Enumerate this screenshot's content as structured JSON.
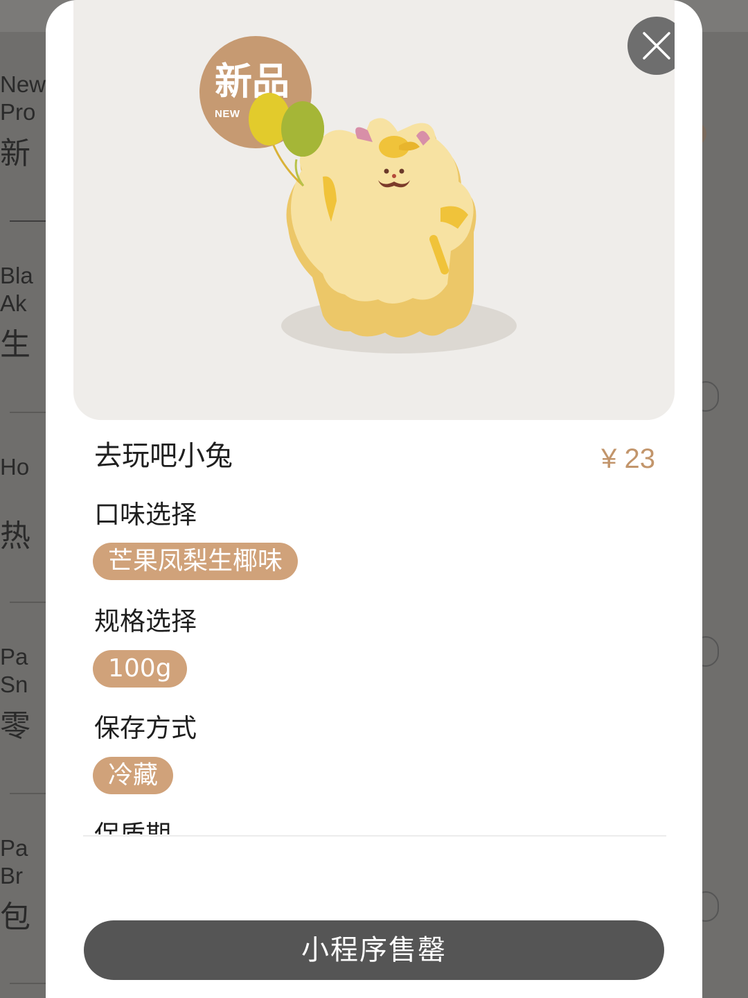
{
  "background_menu": {
    "categories": [
      {
        "en_line1": "New",
        "en_line2": "Pro",
        "zh": "新"
      },
      {
        "en_line1": "Bla",
        "en_line2": "Ak",
        "zh": "生"
      },
      {
        "en_line1": "Ho",
        "en_line2": "",
        "zh": "热"
      },
      {
        "en_line1": "Pa",
        "en_line2": "Sn",
        "zh": "零"
      },
      {
        "en_line1": "Pa",
        "en_line2": "Br",
        "zh": "包"
      }
    ]
  },
  "product": {
    "badge_zh": "新品",
    "badge_en": "NEW",
    "image_icon": "bunny-cake-with-balloons",
    "name": "去玩吧小兔",
    "price": "¥ 23"
  },
  "options": {
    "flavor": {
      "label": "口味选择",
      "selected": "芒果凤梨生椰味"
    },
    "size": {
      "label": "规格选择",
      "selected": "100g"
    },
    "storage": {
      "label": "保存方式",
      "selected": "冷藏"
    },
    "shelf_life": {
      "label": "保质期"
    }
  },
  "actions": {
    "sold_out_label": "小程序售罄",
    "close_icon": "close-icon"
  },
  "colors": {
    "accent": "#c2956b",
    "chip": "#d0a27a",
    "button": "#555555",
    "overlay": "#6f6e6c"
  }
}
